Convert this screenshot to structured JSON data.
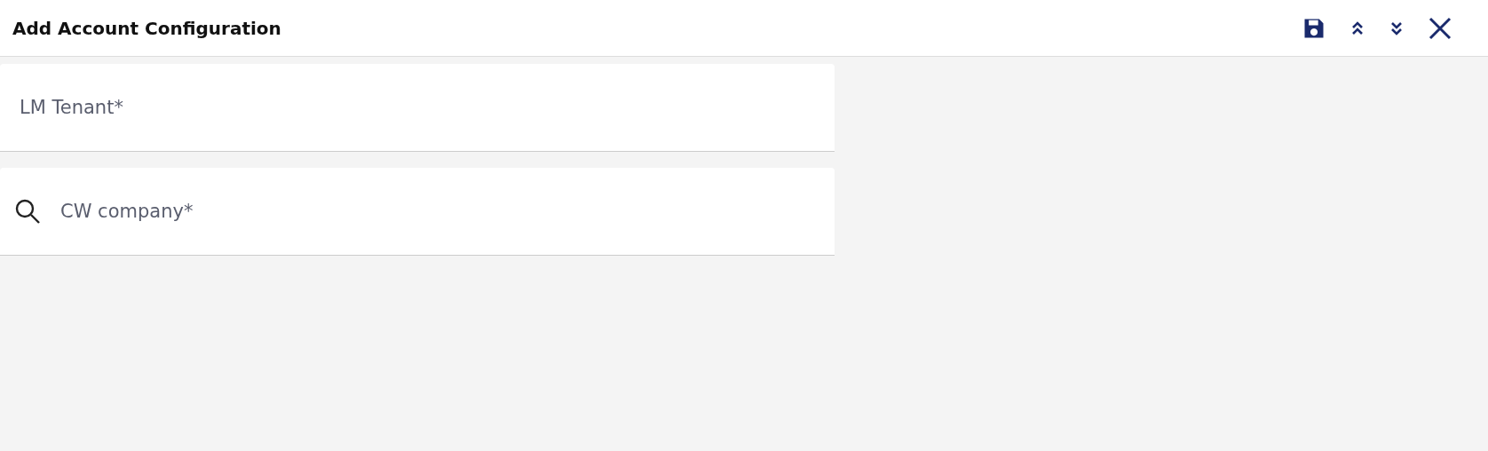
{
  "header": {
    "title": "Add Account Configuration"
  },
  "fields": [
    {
      "kind": "text",
      "placeholder": "LM Tenant*"
    },
    {
      "kind": "search",
      "placeholder": "CW company*"
    }
  ]
}
